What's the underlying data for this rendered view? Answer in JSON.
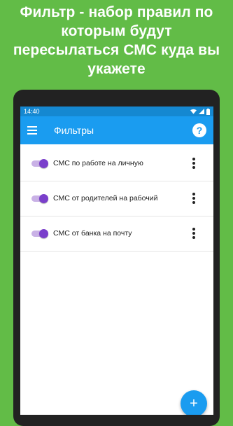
{
  "promo": {
    "line1": "Фильтр - набор правил по",
    "line2": "которым будут",
    "line3": "пересылаться СМС куда вы",
    "line4": "укажете"
  },
  "status_bar": {
    "time": "14:40",
    "icons": [
      "wifi-icon",
      "signal-icon",
      "battery-icon"
    ]
  },
  "app_bar": {
    "title": "Фильтры",
    "help_label": "?"
  },
  "filters": [
    {
      "label": "СМС по работе на личную",
      "enabled": true
    },
    {
      "label": "СМС от родителей на рабочий",
      "enabled": true
    },
    {
      "label": "СМС от банка на почту",
      "enabled": true
    }
  ],
  "fab": {
    "label": "+"
  },
  "colors": {
    "background": "#62bc47",
    "app_bar": "#1a9cf0",
    "status_bar": "#1588d1",
    "toggle_on": "#7a3fcb"
  }
}
